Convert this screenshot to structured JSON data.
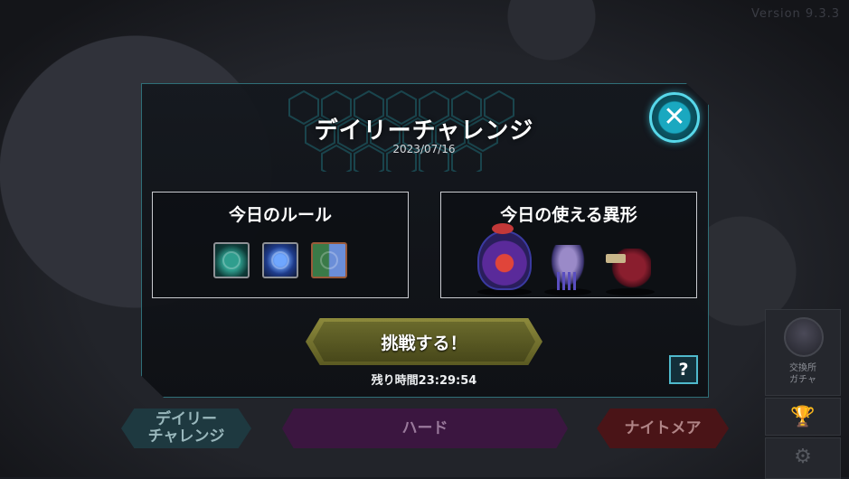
{
  "background": {
    "version": "Version 9.3.3",
    "bottom_tabs": [
      {
        "label": "デイリー\nチャレンジ"
      },
      {
        "label": "ハード"
      },
      {
        "label": "ナイトメア"
      }
    ],
    "side": {
      "exchange_label": "交換所\nガチャ",
      "icons": [
        "avatar-icon",
        "trophy-icon",
        "gear-icon"
      ]
    }
  },
  "modal": {
    "title": "デイリーチャレンジ",
    "date": "2023/07/16",
    "close_icon": "close-icon",
    "rules_panel": {
      "title": "今日のルール",
      "icons": [
        "teal-beast-rule-icon",
        "blue-dragonfly-rule-icon",
        "armor-rule-icon"
      ]
    },
    "monsters_panel": {
      "title": "今日の使える異形",
      "monsters": [
        "red-jellyfish-monster",
        "purple-squid-monster",
        "crimson-knight-monster"
      ]
    },
    "challenge_button": "挑戦する！",
    "timer": "残り時間23:29:54",
    "help_button": "?"
  },
  "colors": {
    "accent_cyan": "#57d8ea",
    "button_gold": "#8d8a3c"
  }
}
